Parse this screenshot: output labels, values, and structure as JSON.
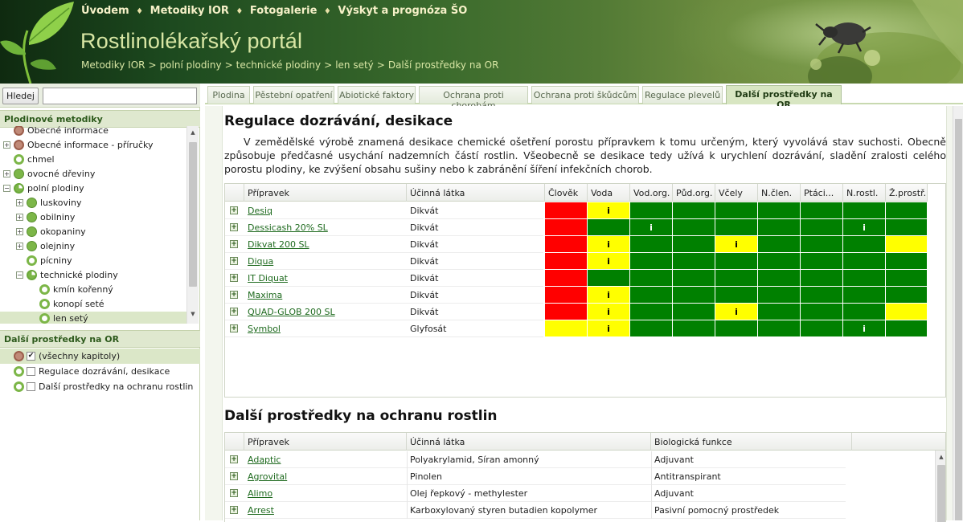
{
  "header": {
    "nav": [
      "Úvodem",
      "Metodiky IOR",
      "Fotogalerie",
      "Výskyt a prognóza ŠO"
    ],
    "nav_sep": "♦",
    "title": "Rostlinolékařský portál",
    "breadcrumb": [
      "Metodiky IOR",
      "polní plodiny",
      "technické plodiny",
      "len setý",
      "Další prostředky na OR"
    ],
    "breadcrumb_sep": ">"
  },
  "left": {
    "search_button": "Hledej",
    "search_value": "",
    "tree_title": "Plodinové metodiky",
    "tree": [
      {
        "label": "Obecné informace",
        "indent": 0,
        "toggle": "",
        "node": "brown"
      },
      {
        "label": "Obecné informace - příručky",
        "indent": 0,
        "toggle": "+",
        "node": "brown"
      },
      {
        "label": "chmel",
        "indent": 0,
        "toggle": "",
        "node": "ring"
      },
      {
        "label": "ovocné dřeviny",
        "indent": 0,
        "toggle": "+",
        "node": "green"
      },
      {
        "label": "polní plodiny",
        "indent": 0,
        "toggle": "−",
        "node": "half"
      },
      {
        "label": "luskoviny",
        "indent": 1,
        "toggle": "+",
        "node": "green"
      },
      {
        "label": "obilniny",
        "indent": 1,
        "toggle": "+",
        "node": "green"
      },
      {
        "label": "okopaniny",
        "indent": 1,
        "toggle": "+",
        "node": "green"
      },
      {
        "label": "olejniny",
        "indent": 1,
        "toggle": "+",
        "node": "green"
      },
      {
        "label": "pícniny",
        "indent": 1,
        "toggle": "",
        "node": "ring"
      },
      {
        "label": "technické plodiny",
        "indent": 1,
        "toggle": "−",
        "node": "half"
      },
      {
        "label": "kmín kořenný",
        "indent": 2,
        "toggle": "",
        "node": "ring"
      },
      {
        "label": "konopí seté",
        "indent": 2,
        "toggle": "",
        "node": "ring"
      },
      {
        "label": "len setý",
        "indent": 2,
        "toggle": "",
        "node": "ring",
        "selected": true
      }
    ],
    "chapters_title": "Další prostředky na OR",
    "chapters": [
      {
        "label": "(všechny kapitoly)",
        "checked": true,
        "selected": true,
        "node": "brown"
      },
      {
        "label": "Regulace dozrávání, desikace",
        "checked": false,
        "node": "ring"
      },
      {
        "label": "Další prostředky na ochranu rostlin",
        "checked": false,
        "node": "ring"
      }
    ]
  },
  "tabs": [
    {
      "label": "Plodina"
    },
    {
      "label": "Pěstební opatření"
    },
    {
      "label": "Abiotické faktory"
    },
    {
      "label": "Ochrana proti chorobám"
    },
    {
      "label": "Ochrana proti škůdcům"
    },
    {
      "label": "Regulace plevelů"
    },
    {
      "label": "Další prostředky na OR",
      "active": true
    }
  ],
  "section1": {
    "title": "Regulace dozrávání, desikace",
    "description": "V zemědělské výrobě znamená desikace chemické ošetření porostu přípravkem k tomu určeným, který vyvolává stav suchosti. Obecně způsobuje předčasné usychání nadzemních částí rostlin. Všeobecně se desikace tedy užívá k urychlení dozrávání, sladění zralosti celého porostu plodiny, ke zvýšení obsahu sušiny nebo k zabránění šíření infekčních chorob.",
    "columns": [
      "Přípravek",
      "Účinná látka",
      "Člověk",
      "Voda",
      "Vod.org.",
      "Půd.org.",
      "Včely",
      "N.člen.",
      "Ptáci...",
      "N.rostl.",
      "Ž.prostř."
    ],
    "colors": {
      "R": "#ff0000",
      "Y": "#ffff00",
      "G": "#008000"
    },
    "rows": [
      {
        "name": "Desiq",
        "substance": "Dikvát",
        "cells": [
          "R",
          "Y",
          "G",
          "G",
          "G",
          "G",
          "G",
          "G",
          "G"
        ],
        "info": [
          false,
          true,
          false,
          false,
          false,
          false,
          false,
          false,
          false
        ]
      },
      {
        "name": "Dessicash 20% SL",
        "substance": "Dikvát",
        "cells": [
          "R",
          "G",
          "G",
          "G",
          "G",
          "G",
          "G",
          "G",
          "G"
        ],
        "info": [
          false,
          false,
          true,
          false,
          false,
          false,
          false,
          true,
          false
        ]
      },
      {
        "name": "Dikvat 200 SL",
        "substance": "Dikvát",
        "cells": [
          "R",
          "Y",
          "G",
          "G",
          "Y",
          "G",
          "G",
          "G",
          "Y"
        ],
        "info": [
          false,
          true,
          false,
          false,
          true,
          false,
          false,
          false,
          false
        ]
      },
      {
        "name": "Diqua",
        "substance": "Dikvát",
        "cells": [
          "R",
          "Y",
          "G",
          "G",
          "G",
          "G",
          "G",
          "G",
          "G"
        ],
        "info": [
          false,
          true,
          false,
          false,
          false,
          false,
          false,
          false,
          false
        ]
      },
      {
        "name": "IT Diquat",
        "substance": "Dikvát",
        "cells": [
          "R",
          "G",
          "G",
          "G",
          "G",
          "G",
          "G",
          "G",
          "G"
        ],
        "info": [
          false,
          false,
          false,
          false,
          false,
          false,
          false,
          false,
          false
        ]
      },
      {
        "name": "Maxima",
        "substance": "Dikvát",
        "cells": [
          "R",
          "Y",
          "G",
          "G",
          "G",
          "G",
          "G",
          "G",
          "G"
        ],
        "info": [
          false,
          true,
          false,
          false,
          false,
          false,
          false,
          false,
          false
        ]
      },
      {
        "name": "QUAD-GLOB 200 SL",
        "substance": "Dikvát",
        "cells": [
          "R",
          "Y",
          "G",
          "G",
          "Y",
          "G",
          "G",
          "G",
          "Y"
        ],
        "info": [
          false,
          true,
          false,
          false,
          true,
          false,
          false,
          false,
          false
        ]
      },
      {
        "name": "Symbol",
        "substance": "Glyfosát",
        "cells": [
          "Y",
          "Y",
          "G",
          "G",
          "G",
          "G",
          "G",
          "G",
          "G"
        ],
        "info": [
          false,
          true,
          false,
          false,
          false,
          false,
          false,
          true,
          false
        ]
      }
    ],
    "info_mark": "i"
  },
  "section2": {
    "title": "Další prostředky na ochranu rostlin",
    "columns": [
      "Přípravek",
      "Účinná látka",
      "Biologická funkce"
    ],
    "rows": [
      {
        "name": "Adaptic",
        "substance": "Polyakrylamid, Síran amonný",
        "function": "Adjuvant"
      },
      {
        "name": "Agrovital",
        "substance": "Pinolen",
        "function": "Antitranspirant"
      },
      {
        "name": "Alimo",
        "substance": "Olej řepkový - methylester",
        "function": "Adjuvant"
      },
      {
        "name": "Arrest",
        "substance": "Karboxylovaný styren butadien kopolymer",
        "function": "Pasivní pomocný prostředek"
      }
    ]
  }
}
